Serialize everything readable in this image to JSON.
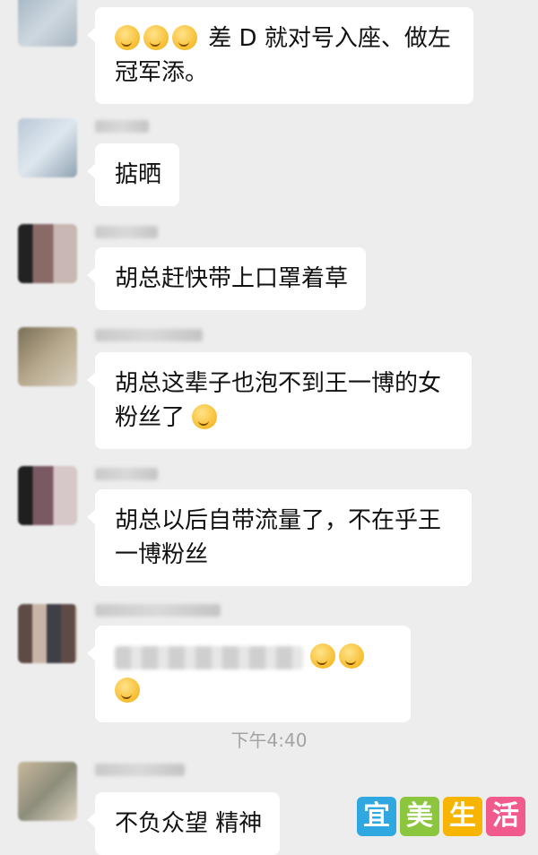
{
  "messages": [
    {
      "text": "差 D 就对号入座、做左冠军添。",
      "emoji_before": 3
    },
    {
      "text": "掂晒"
    },
    {
      "text": "胡总赶快带上口罩着草"
    },
    {
      "text": "胡总这辈子也泡不到王一博的女粉丝了",
      "emoji_after": 1
    },
    {
      "text": "胡总以后自带流量了，不在乎王一博粉丝"
    },
    {
      "text": "",
      "emoji_after": 3,
      "blurred": true
    },
    {
      "text": "不负众望  精神"
    }
  ],
  "timestamp": "下午4:40",
  "watermark": {
    "chars": [
      "宜",
      "美",
      "生",
      "活"
    ],
    "colors": [
      "#2fa7e0",
      "#8cc63f",
      "#f7b500",
      "#f05a8c"
    ]
  },
  "icons": [
    "emoji-grin-icon",
    "emoji-laugh-cry-icon"
  ]
}
